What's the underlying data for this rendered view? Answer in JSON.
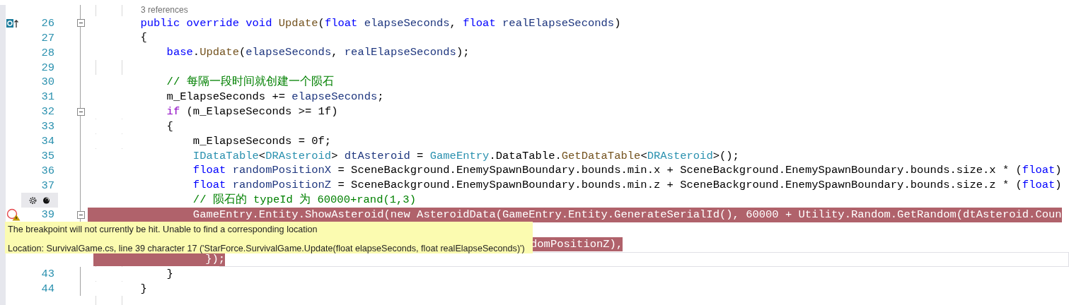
{
  "editor": {
    "lines": [
      {
        "kind": "codelens",
        "text": "3 references"
      },
      {
        "kind": "code",
        "number": "26",
        "marker": {
          "kind": "override"
        },
        "fold": true,
        "tokens": [
          {
            "kind": "kw",
            "text": "        public override void "
          },
          {
            "kind": "method",
            "text": "Update"
          },
          {
            "kind": "plain",
            "text": "("
          },
          {
            "kind": "kw",
            "text": "float "
          },
          {
            "kind": "var",
            "text": "elapseSeconds"
          },
          {
            "kind": "plain",
            "text": ", "
          },
          {
            "kind": "kw",
            "text": "float "
          },
          {
            "kind": "var",
            "text": "realElapseSeconds"
          },
          {
            "kind": "plain",
            "text": ")"
          }
        ]
      },
      {
        "kind": "code",
        "number": "27",
        "tokens": [
          {
            "kind": "plain",
            "text": "        {"
          }
        ]
      },
      {
        "kind": "code",
        "number": "28",
        "tokens": [
          {
            "kind": "kw",
            "text": "            base"
          },
          {
            "kind": "plain",
            "text": "."
          },
          {
            "kind": "method",
            "text": "Update"
          },
          {
            "kind": "plain",
            "text": "("
          },
          {
            "kind": "var",
            "text": "elapseSeconds"
          },
          {
            "kind": "plain",
            "text": ", "
          },
          {
            "kind": "var",
            "text": "realElapseSeconds"
          },
          {
            "kind": "plain",
            "text": ");"
          }
        ]
      },
      {
        "kind": "code",
        "number": "29"
      },
      {
        "kind": "code",
        "number": "30",
        "tokens": [
          {
            "kind": "comment",
            "text": "            // 每隔一段时间就创建一个陨石"
          }
        ]
      },
      {
        "kind": "code",
        "number": "31",
        "tokens": [
          {
            "kind": "plain",
            "text": "            m_ElapseSeconds += "
          },
          {
            "kind": "var",
            "text": "elapseSeconds"
          },
          {
            "kind": "plain",
            "text": ";"
          }
        ]
      },
      {
        "kind": "code",
        "number": "32",
        "fold": true,
        "tokens": [
          {
            "kind": "ctrl",
            "text": "            if"
          },
          {
            "kind": "plain",
            "text": " (m_ElapseSeconds >= 1f)"
          }
        ]
      },
      {
        "kind": "code",
        "number": "33",
        "tokens": [
          {
            "kind": "plain",
            "text": "            {"
          }
        ]
      },
      {
        "kind": "code",
        "number": "34",
        "tokens": [
          {
            "kind": "plain",
            "text": "                m_ElapseSeconds = 0f;"
          }
        ]
      },
      {
        "kind": "code",
        "number": "35",
        "tokens": [
          {
            "kind": "type",
            "text": "                IDataTable"
          },
          {
            "kind": "plain",
            "text": "<"
          },
          {
            "kind": "type",
            "text": "DRAsteroid"
          },
          {
            "kind": "plain",
            "text": "> "
          },
          {
            "kind": "var",
            "text": "dtAsteroid"
          },
          {
            "kind": "plain",
            "text": " = "
          },
          {
            "kind": "type",
            "text": "GameEntry"
          },
          {
            "kind": "plain",
            "text": ".DataTable."
          },
          {
            "kind": "method",
            "text": "GetDataTable"
          },
          {
            "kind": "plain",
            "text": "<"
          },
          {
            "kind": "type",
            "text": "DRAsteroid"
          },
          {
            "kind": "plain",
            "text": ">();"
          }
        ]
      },
      {
        "kind": "code",
        "number": "36",
        "tokens": [
          {
            "kind": "kw",
            "text": "                float "
          },
          {
            "kind": "var",
            "text": "randomPositionX"
          },
          {
            "kind": "plain",
            "text": " = SceneBackground.EnemySpawnBoundary.bounds.min.x + SceneBackground.EnemySpawnBoundary.bounds.size.x * ("
          },
          {
            "kind": "kw",
            "text": "float"
          },
          {
            "kind": "plain",
            "text": ")"
          }
        ]
      },
      {
        "kind": "code",
        "number": "37",
        "tokens": [
          {
            "kind": "kw",
            "text": "                float "
          },
          {
            "kind": "var",
            "text": "randomPositionZ"
          },
          {
            "kind": "plain",
            "text": " = SceneBackground.EnemySpawnBoundary.bounds.min.z + SceneBackground.EnemySpawnBoundary.bounds.size.z * ("
          },
          {
            "kind": "kw",
            "text": "float"
          },
          {
            "kind": "plain",
            "text": ")"
          }
        ]
      },
      {
        "kind": "code",
        "marker": {
          "kind": "actions"
        },
        "tokens": [
          {
            "kind": "comment",
            "text": "                // 陨石的 typeId 为 60000+rand(1,3)"
          }
        ]
      },
      {
        "kind": "code",
        "number": "39",
        "marker": {
          "kind": "breakpoint-warning"
        },
        "fold": true,
        "highlighted": true,
        "tokens": [
          {
            "kind": "plain",
            "text": "                GameEntry.Entity.ShowAsteroid(new AsteroidData(GameEntry.Entity.GenerateSerialId(), 60000 + Utility.Random.GetRandom(dtAsteroid.Coun"
          }
        ]
      },
      {
        "kind": "hidden"
      },
      {
        "kind": "tail",
        "highlighted": true,
        "tokens": [
          {
            "kind": "plain",
            "text": "domPositionZ),"
          }
        ]
      },
      {
        "kind": "code",
        "highlighted": true,
        "current": true,
        "tokens": [
          {
            "kind": "plain",
            "text": "                 });"
          }
        ]
      },
      {
        "kind": "code",
        "number": "43",
        "tokens": [
          {
            "kind": "plain",
            "text": "            }"
          }
        ]
      },
      {
        "kind": "code",
        "number": "44",
        "tokens": [
          {
            "kind": "plain",
            "text": "        }"
          }
        ]
      }
    ]
  },
  "tooltip": {
    "message": "The breakpoint will not currently be hit. Unable to find a corresponding location",
    "location": "Location: SurvivalGame.cs, line 39 character 17 ('StarForce.SurvivalGame.Update(float elapseSeconds, float realElapseSeconds)')"
  }
}
